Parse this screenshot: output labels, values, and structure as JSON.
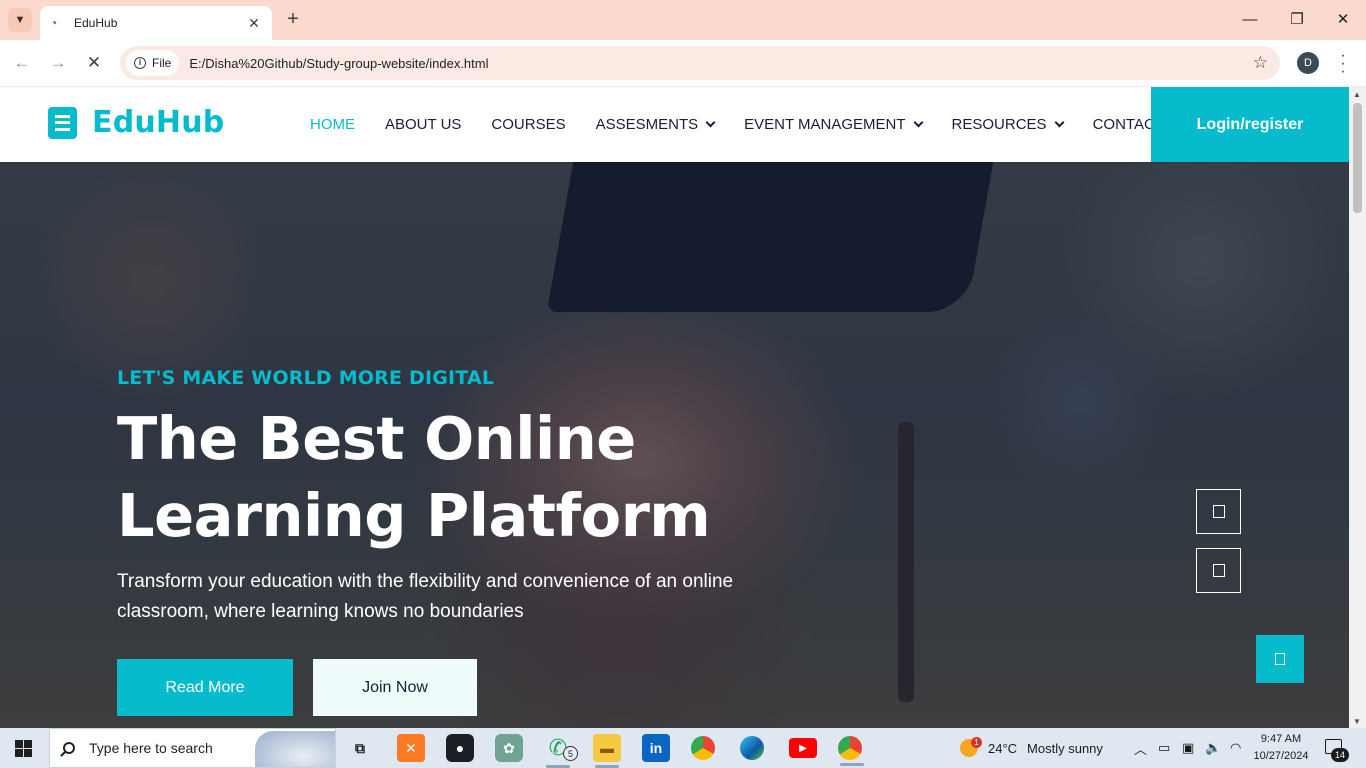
{
  "browser": {
    "tab_title": "EduHub",
    "address_chip": "File",
    "url": "E:/Disha%20Github/Study-group-website/index.html",
    "profile_initial": "D",
    "new_tab": "+",
    "tab_close": "✕",
    "minimize": "—",
    "restore": "❐",
    "close": "✕",
    "back": "←",
    "forward": "→",
    "stop": "✕",
    "star": "☆"
  },
  "site": {
    "brand": "EduHub",
    "nav": [
      {
        "label": "HOME",
        "active": true
      },
      {
        "label": "ABOUT US"
      },
      {
        "label": "COURSES"
      },
      {
        "label": "ASSESMENTS",
        "dropdown": true
      },
      {
        "label": "EVENT MANAGEMENT",
        "dropdown": true
      },
      {
        "label": "RESOURCES",
        "dropdown": true
      },
      {
        "label": "CONTACT"
      }
    ],
    "login": "Login/register",
    "accent_color": "#06bbcc",
    "dark_color": "#181d38"
  },
  "hero": {
    "eyebrow": "LET'S MAKE WORLD MORE DIGITAL",
    "headline": "The Best Online Learning Platform",
    "subtext": "Transform your education with the flexibility and convenience of an online classroom, where learning knows no boundaries",
    "read_more": "Read More",
    "join_now": "Join Now"
  },
  "taskbar": {
    "search_placeholder": "Type here to search",
    "whatsapp_badge": "5",
    "weather_badge": "1",
    "temperature": "24°C",
    "weather": "Mostly sunny",
    "time": "9:47 AM",
    "date": "10/27/2024",
    "notifications": "14",
    "apps": [
      "task-view-icon",
      "xampp-icon",
      "github-icon",
      "chatgpt-icon",
      "whatsapp-icon",
      "file-explorer-icon",
      "linkedin-icon",
      "chrome-icon",
      "edge-icon",
      "youtube-icon",
      "chrome-profile-icon"
    ]
  }
}
